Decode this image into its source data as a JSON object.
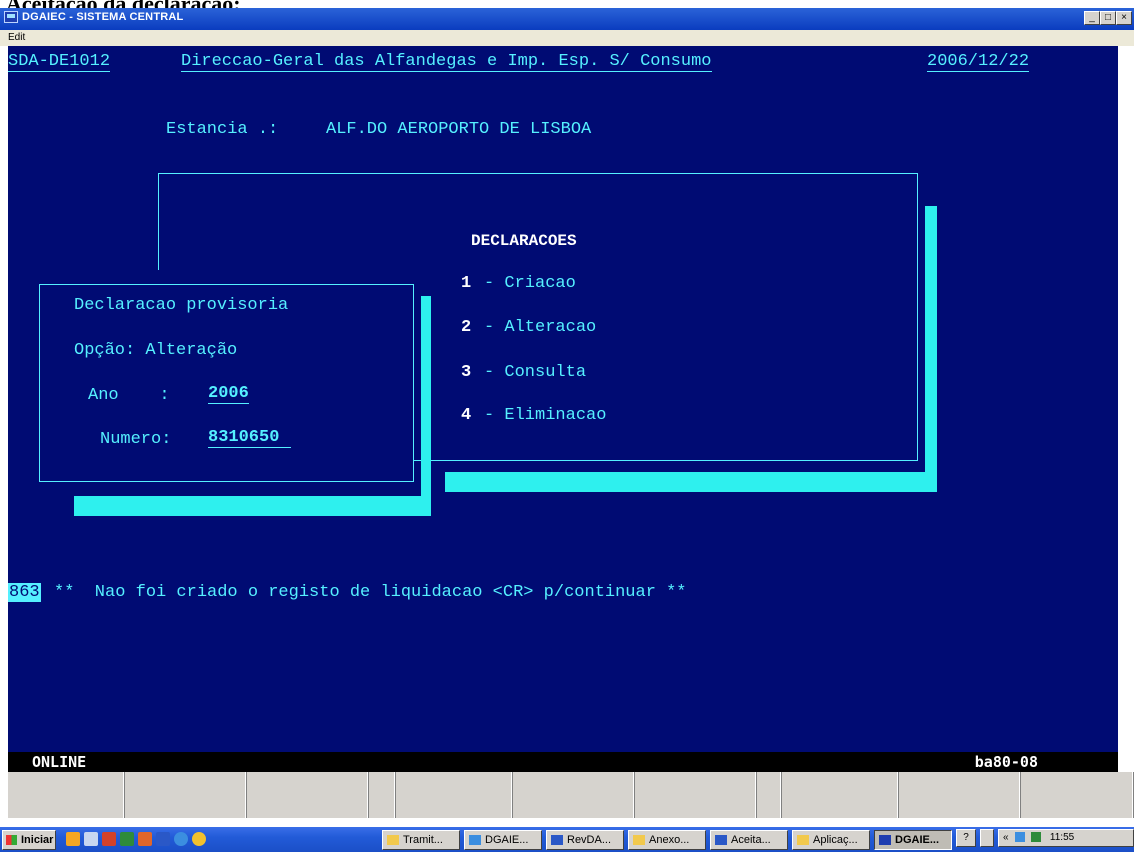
{
  "caption": "Aceitação da declaração:",
  "window": {
    "title": "DGAIEC - SISTEMA CENTRAL",
    "menu": "Edit",
    "btn_min": "_",
    "btn_max": "□",
    "btn_close": "×"
  },
  "header": {
    "program": "SDA-DE1012",
    "org": "Direccao-Geral das Alfandegas e Imp. Esp. S/ Consumo",
    "date": "2006/12/22"
  },
  "station": {
    "label": "Estancia .:",
    "value": "ALF.DO AEROPORTO DE LISBOA"
  },
  "menu": {
    "title": "DECLARACOES",
    "items": [
      {
        "num": "1",
        "label": "- Criacao"
      },
      {
        "num": "2",
        "label": "- Alteracao"
      },
      {
        "num": "3",
        "label": "- Consulta"
      },
      {
        "num": "4",
        "label": "- Eliminacao"
      }
    ]
  },
  "dialog": {
    "title": "Declaracao provisoria",
    "option": "Opção: Alteração",
    "year_label": "Ano    :",
    "year_value": "2006",
    "number_label": "Numero:",
    "number_value": "8310650"
  },
  "message": {
    "code": "863",
    "text": "**  Nao foi criado o registo de liquidacao <CR> p/continuar **"
  },
  "status": {
    "left": "ONLINE",
    "right": "ba80-08"
  },
  "taskbar": {
    "start": "Iniciar",
    "buttons": [
      {
        "label": "Tramit...",
        "icon": "folder-icon"
      },
      {
        "label": "DGAIE...",
        "icon": "ie-icon"
      },
      {
        "label": "RevDA...",
        "icon": "word-icon"
      },
      {
        "label": "Anexo...",
        "icon": "folder-icon"
      },
      {
        "label": "Aceita...",
        "icon": "word-icon"
      },
      {
        "label": "Aplicaç...",
        "icon": "folder-icon"
      },
      {
        "label": "DGAIE...",
        "icon": "terminal-icon"
      }
    ],
    "tray_help": "?",
    "tray_arrows": "«",
    "clock": "11:55"
  },
  "colors": {
    "terminal_bg": "#000b73",
    "terminal_fg": "#55f0ff",
    "shadow": "#2ef0ee"
  }
}
